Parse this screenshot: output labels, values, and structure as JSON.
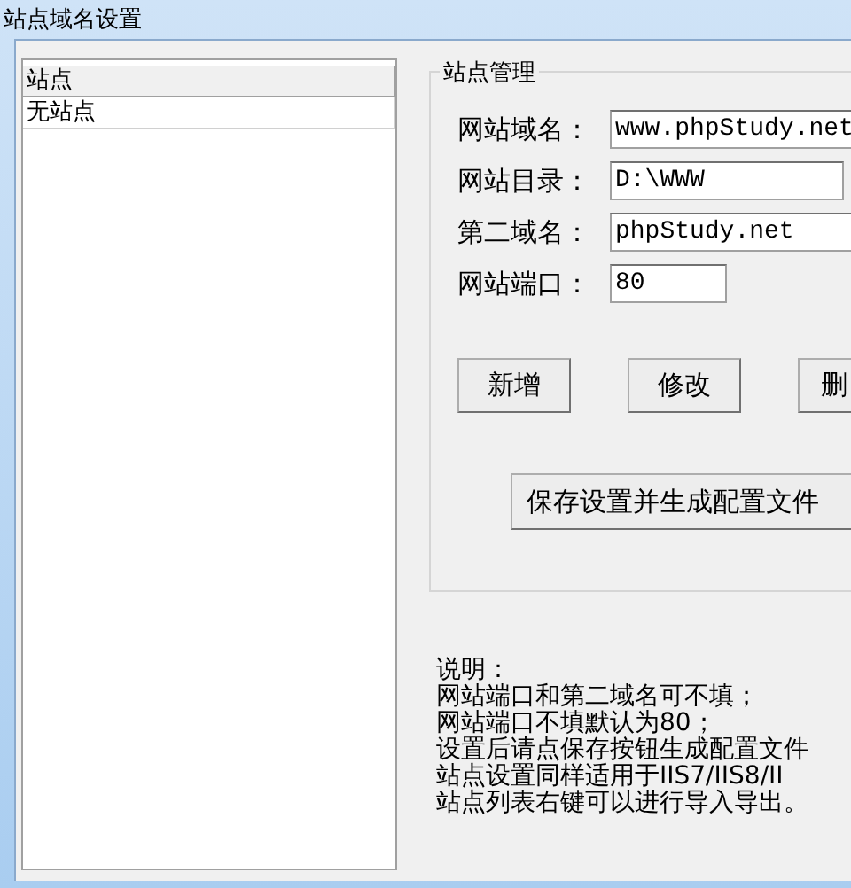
{
  "window": {
    "title": "站点域名设置"
  },
  "site_list": {
    "column": "站点",
    "rows": [
      {
        "label": "无站点",
        "selected": false
      }
    ]
  },
  "group": {
    "title": "站点管理",
    "fields": [
      {
        "label": "网站域名：",
        "value": "www.phpStudy.net",
        "kind": "wide"
      },
      {
        "label": "网站目录：",
        "value": "D:\\WWW",
        "kind": "browse"
      },
      {
        "label": "第二域名：",
        "value": "phpStudy.net",
        "kind": "wide"
      },
      {
        "label": "网站端口：",
        "value": "80",
        "kind": "short"
      }
    ],
    "buttons": [
      "新增",
      "修改",
      "删"
    ],
    "save_button": "保存设置并生成配置文件"
  },
  "notes": [
    "说明：",
    "网站端口和第二域名可不填；",
    "网站端口不填默认为80；",
    "设置后请点保存按钮生成配置文件",
    "站点设置同样适用于IIS7/IIS8/II",
    "站点列表右键可以进行导入导出。"
  ]
}
